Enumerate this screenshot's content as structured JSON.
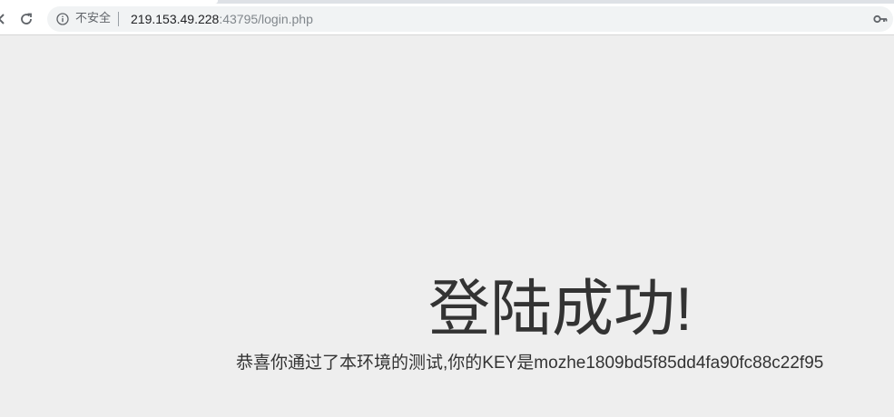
{
  "browser": {
    "security_label": "不安全",
    "url_host": "219.153.49.228",
    "url_rest": ":43795/login.php",
    "icons": {
      "back": "arrow-left-icon",
      "reload": "reload-icon",
      "info": "info-icon",
      "password": "key-icon"
    }
  },
  "page": {
    "title": "登陆成功!",
    "message": "恭喜你通过了本环境的测试,你的KEY是mozhe1809bd5f85dd4fa90fc88c22f95"
  },
  "colors": {
    "page_background": "#eeeeee",
    "text": "#333333",
    "omnibox": "#f1f3f4"
  }
}
